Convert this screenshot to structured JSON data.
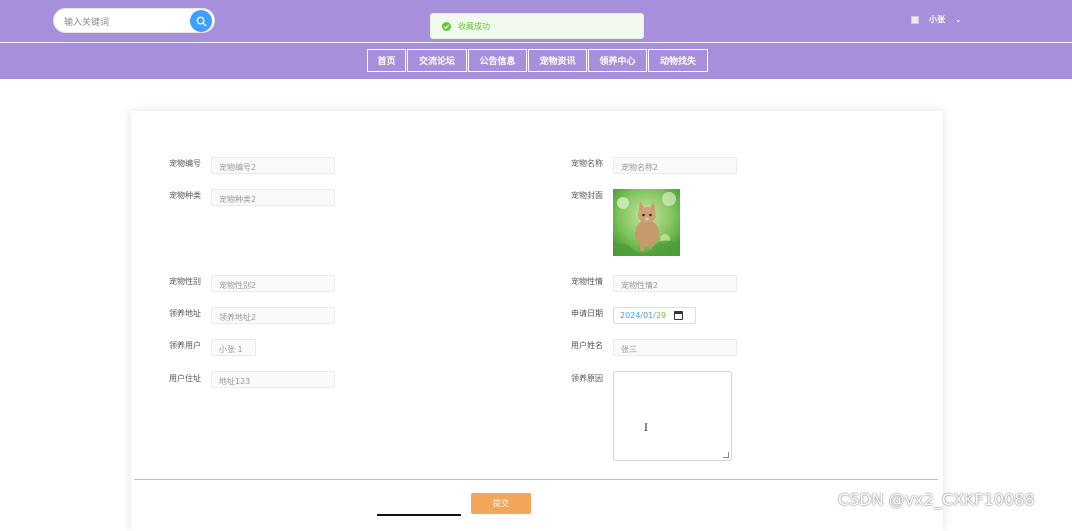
{
  "header": {
    "search_placeholder": "输入关键词",
    "toast_message": "收藏成功",
    "user_name": "小张",
    "user_caret": "⌄",
    "nav": [
      "首页",
      "交流论坛",
      "公告信息",
      "宠物资讯",
      "领养中心",
      "动物找失"
    ]
  },
  "form": {
    "pet_no_label": "宠物编号",
    "pet_no_value": "宠物编号2",
    "pet_name_label": "宠物名称",
    "pet_name_value": "宠物名称2",
    "pet_type_label": "宠物种类",
    "pet_type_value": "宠物种类2",
    "pet_cover_label": "宠物封面",
    "pet_gender_label": "宠物性别",
    "pet_gender_value": "宠物性别2",
    "pet_temper_label": "宠物性情",
    "pet_temper_value": "宠物性情2",
    "adopt_addr_label": "领养地址",
    "adopt_addr_value": "领养地址2",
    "apply_date_label": "申请日期",
    "apply_date_year": "2024",
    "apply_date_sep": "/",
    "apply_date_month": "01",
    "apply_date_day": "29",
    "adopt_user_label": "领养用户",
    "adopt_user_value": "小张 1",
    "user_realname_label": "用户姓名",
    "user_realname_value": "张三",
    "user_addr_label": "用户住址",
    "user_addr_value": "地址123",
    "adopt_reason_label": "领养原因",
    "submit_label": "提交"
  },
  "watermark": "CSDN @vx2_CXKF10088",
  "colors": {
    "header_bg": "#a78fdb",
    "primary": "#409eff",
    "success": "#67c23a",
    "submit": "#f2a65a"
  }
}
